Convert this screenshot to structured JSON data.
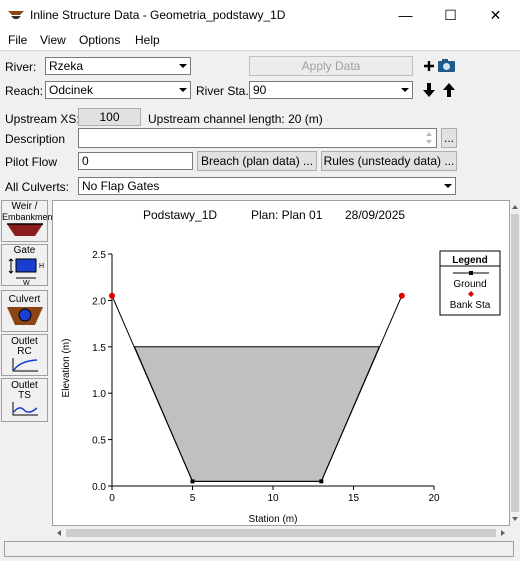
{
  "window": {
    "title": "Inline Structure Data - Geometria_podstawy_1D",
    "minimize": "—",
    "maximize": "☐",
    "close": "✕"
  },
  "menu": [
    "File",
    "View",
    "Options",
    "Help"
  ],
  "river": {
    "label": "River:",
    "value": "Rzeka"
  },
  "reach": {
    "label": "Reach:",
    "value": "Odcinek"
  },
  "river_sta": {
    "label": "River Sta.:",
    "value": "90"
  },
  "apply_button": "Apply Data",
  "upstream_xs": {
    "label": "Upstream XS:",
    "button": "100",
    "length_text": "Upstream channel length: 20 (m)"
  },
  "description": {
    "label": "Description",
    "value": "",
    "button": "..."
  },
  "pilot_flow": {
    "label": "Pilot Flow",
    "value": "0"
  },
  "breach_button": "Breach (plan data) ...",
  "rules_button": "Rules (unsteady data) ...",
  "culverts": {
    "label": "All Culverts:",
    "value": "No Flap Gates"
  },
  "tools": [
    {
      "label1": "Weir /",
      "label2": "Embankment"
    },
    {
      "label1": "Gate",
      "label2": "",
      "h": "H",
      "w": "W"
    },
    {
      "label1": "Culvert",
      "label2": ""
    },
    {
      "label1": "Outlet",
      "label2": "RC"
    },
    {
      "label1": "Outlet",
      "label2": "TS"
    }
  ],
  "plot_header": {
    "name": "Podstawy_1D",
    "plan": "Plan: Plan 01",
    "date": "28/09/2025"
  },
  "legend": {
    "title": "Legend",
    "ground": "Ground",
    "bank": "Bank Sta"
  },
  "colors": {
    "fill": "#c0c0c0",
    "bank": "#e00000",
    "ground": "#000000"
  },
  "chart_data": {
    "type": "line",
    "xlabel": "Station (m)",
    "ylabel": "Elevation (m)",
    "xlim": [
      0,
      20
    ],
    "ylim": [
      0,
      2.5
    ],
    "xticks": [
      0,
      5,
      10,
      15,
      20
    ],
    "yticks": [
      0.0,
      0.5,
      1.0,
      1.5,
      2.0,
      2.5
    ],
    "ground": [
      [
        0,
        2.05
      ],
      [
        5,
        0.05
      ],
      [
        13,
        0.05
      ],
      [
        18,
        2.05
      ]
    ],
    "bank_sta": [
      [
        0,
        2.05
      ],
      [
        18,
        2.05
      ]
    ],
    "deck_polygon": [
      [
        1.4,
        1.5
      ],
      [
        16.6,
        1.5
      ],
      [
        13,
        0.05
      ],
      [
        5,
        0.05
      ]
    ]
  }
}
